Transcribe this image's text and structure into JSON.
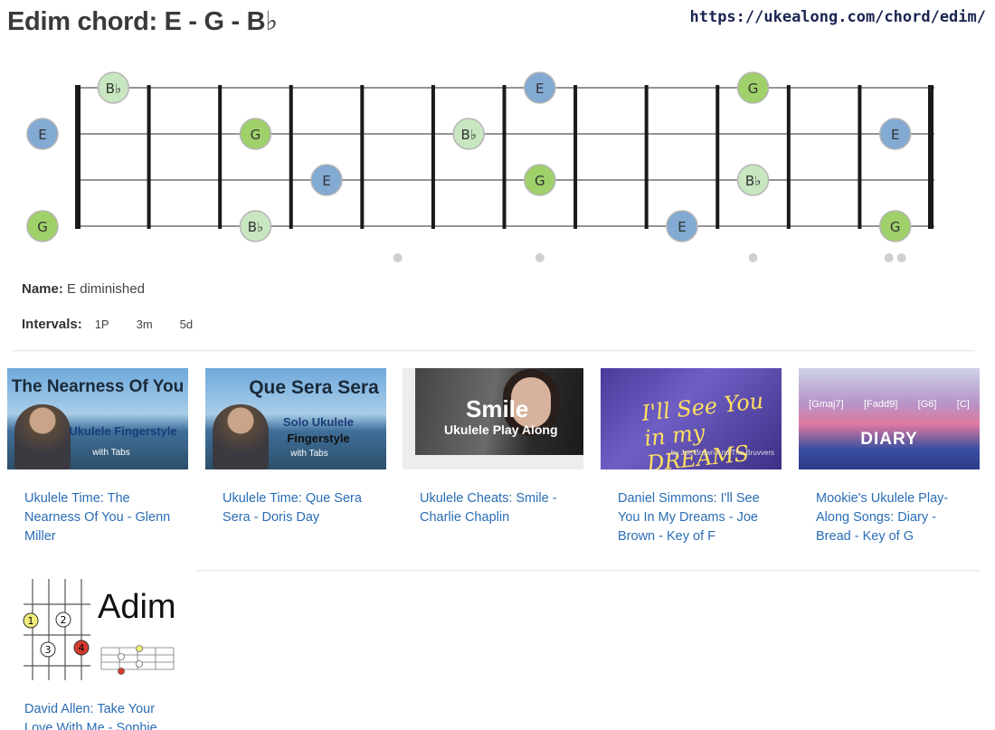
{
  "header": {
    "title": "Edim chord: E - G - B♭",
    "url": "https://ukealong.com/chord/edim/"
  },
  "fretboard": {
    "strings": [
      "A",
      "E",
      "C",
      "G"
    ],
    "fret_count": 12,
    "inlay_frets": [
      5,
      7,
      10,
      12
    ],
    "notes": [
      {
        "string": 0,
        "fret": 1,
        "label": "B♭",
        "color": "#c8e6c0"
      },
      {
        "string": 0,
        "fret": 7,
        "label": "E",
        "color": "#82aad3"
      },
      {
        "string": 0,
        "fret": 10,
        "label": "G",
        "color": "#9fd06a"
      },
      {
        "string": 1,
        "fret": 0,
        "label": "E",
        "color": "#82aad3"
      },
      {
        "string": 1,
        "fret": 3,
        "label": "G",
        "color": "#9fd06a"
      },
      {
        "string": 1,
        "fret": 6,
        "label": "B♭",
        "color": "#c8e6c0"
      },
      {
        "string": 1,
        "fret": 12,
        "label": "E",
        "color": "#82aad3"
      },
      {
        "string": 2,
        "fret": 4,
        "label": "E",
        "color": "#82aad3"
      },
      {
        "string": 2,
        "fret": 7,
        "label": "G",
        "color": "#9fd06a"
      },
      {
        "string": 2,
        "fret": 10,
        "label": "B♭",
        "color": "#c8e6c0"
      },
      {
        "string": 3,
        "fret": 0,
        "label": "G",
        "color": "#9fd06a"
      },
      {
        "string": 3,
        "fret": 3,
        "label": "B♭",
        "color": "#c8e6c0"
      },
      {
        "string": 3,
        "fret": 9,
        "label": "E",
        "color": "#82aad3"
      },
      {
        "string": 3,
        "fret": 12,
        "label": "G",
        "color": "#9fd06a"
      }
    ]
  },
  "info": {
    "name_label": "Name:",
    "name_value": "E diminished",
    "intervals_label": "Intervals:",
    "intervals": [
      "1P",
      "3m",
      "5d"
    ]
  },
  "videos": [
    {
      "title": "Ukulele Time: The Nearness Of You - Glenn Miller",
      "thumb_text": [
        "The Nearness Of You",
        "Ukulele Fingerstyle",
        "with Tabs"
      ]
    },
    {
      "title": "Ukulele Time: Que Sera Sera - Doris Day",
      "thumb_text": [
        "Que Sera Sera",
        "Solo Ukulele",
        "Fingerstyle",
        "with Tabs"
      ]
    },
    {
      "title": "Ukulele Cheats: Smile - Charlie Chaplin",
      "thumb_text": [
        "Smile",
        "Ukulele Play Along"
      ]
    },
    {
      "title": "Daniel Simmons: I'll See You In My Dreams - Joe Brown - Key of F",
      "thumb_text": [
        "I'll See You in my DREAMS",
        "...by Joe Brown And The Bruvvers"
      ]
    },
    {
      "title": "Mookie's Ukulele Play-Along Songs: Diary - Bread - Key of G",
      "thumb_text": [
        "[Gmaj7]",
        "[Fadd9]",
        "[G6]",
        "[C]",
        "DIARY"
      ]
    },
    {
      "title": "David Allen: Take Your Love With Me - Sophie",
      "thumb_text": [
        "Adim"
      ]
    }
  ],
  "colors": {
    "note_E": "#82aad3",
    "note_G": "#9fd06a",
    "note_Bb": "#c8e6c0",
    "link": "#2a6db5"
  }
}
